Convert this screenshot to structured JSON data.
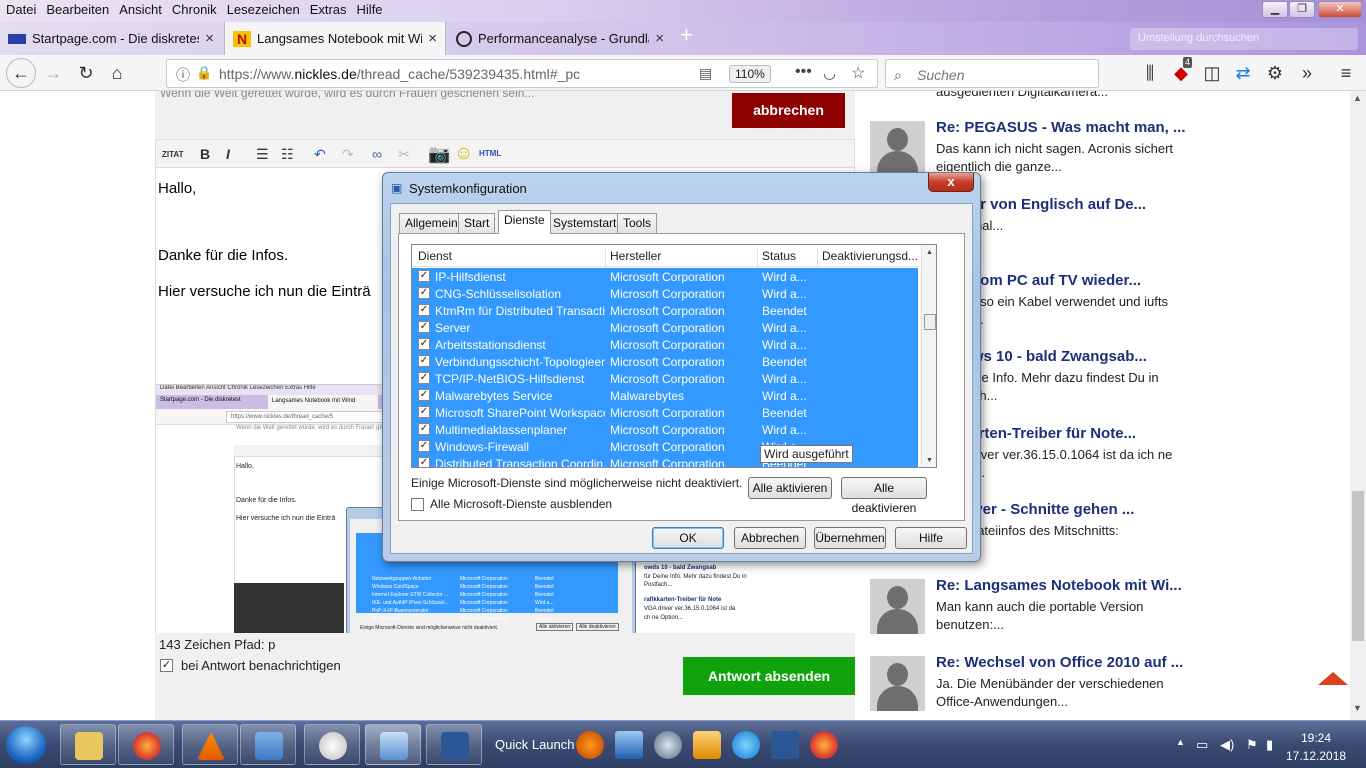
{
  "menu": [
    "Datei",
    "Bearbeiten",
    "Ansicht",
    "Chronik",
    "Lesezeichen",
    "Extras",
    "Hilfe"
  ],
  "tabs": [
    {
      "label": "Startpage.com - Die diskreteste",
      "close": "×"
    },
    {
      "label": "Langsames Notebook mit Windo",
      "close": "×"
    },
    {
      "label": "Performanceanalyse - Grundlage",
      "close": "×"
    }
  ],
  "newtab": "+",
  "ghost_search": "Umstellung durchsuchen",
  "nav": {
    "url_prefix": "https://www.",
    "url_domain": "nickles.de",
    "url_path": "/thread_cache/539239435.html#_pc",
    "zoom": "110%",
    "search_placeholder": "Suchen",
    "badge": "4"
  },
  "page": {
    "partial_line": "Wenn die Welt gerettet würde, wird es durch Frauen geschehen sein...",
    "cancel": "abbrechen",
    "toolbar": {
      "zitat": "ZITAT",
      "bold": "B",
      "italic": "I",
      "html": "HTML"
    },
    "editor_lines": [
      "Hallo,",
      "Danke für die Infos.",
      "Hier versuche ich nun die Einträ"
    ],
    "status": "143 Zeichen Pfad: p",
    "notify": "bei Antwort benachrichtigen",
    "send": "Antwort absenden"
  },
  "inner": {
    "menu": "Datei  Bearbeiten  Ansicht  Chronik  Lesezeichen  Extras  Hilfe",
    "tab1": "Startpage.com - Die diskretest",
    "tab2": "Langsames Notebook mit Wind",
    "url": "https://www.nickles.de/thread_cache/5",
    "partial": "Wenn die Welt gerettet würde, wird es durch Frauen ge",
    "lines": [
      "Hallo,",
      "Danke für die Infos.",
      "Hier versuche ich nun die Einträ"
    ],
    "rows": [
      [
        "Netzwerkgruppen-Anbieter",
        "Microsoft Corporation",
        "Beendet"
      ],
      [
        "Windows CardSpace",
        "Microsoft Corporation",
        "Beendet"
      ],
      [
        "Internet Explorer ETW Collector ...",
        "Microsoft Corporation",
        "Beendet"
      ],
      [
        "IKE- und AuthIP IPsec-Schlüssel...",
        "Microsoft Corporation",
        "Wird a..."
      ],
      [
        "PnP-X-IP-Busenumerator",
        "Microsoft Corporation",
        "Beendet"
      ],
      [
        "IP-Hilfsdienst",
        "Microsoft Corporation",
        "Wird a..."
      ]
    ],
    "note": "Einige Microsoft-Dienste sind möglicherweise nicht deaktiviert.",
    "btn1": "Alle aktivieren",
    "btn2": "Alle deaktivieren",
    "right1": "owds 10 - bald Zwangsab",
    "right2": "für Deine Info. Mehr dazu findest Du in",
    "right3": "Postfach...",
    "right4": "rafikkarten-Treiber für Note",
    "right5": "VGA driver ver.36.15.0.1064 ist da",
    "right6": "ch ne Option..."
  },
  "right_posts": [
    {
      "title": "",
      "text": "ausgedienten Digitalkamera...",
      "avatar": false
    },
    {
      "title": "Re: PEGASUS - Was macht man, ...",
      "text": "Das kann ich nicht sagen. Acronis sichert eigentlich die ganze...",
      "avatar": true
    },
    {
      "title": "astatur von Englisch auf De...",
      "text": "ne es mal...",
      "avatar": false
    },
    {
      "title": "otos vom PC auf TV wieder...",
      "text": "t hat er so ein Kabel verwendet und iufts sowas...",
      "avatar": false
    },
    {
      "title": "/indows 10 - bald Zwangsab...",
      "text": "für Deine Info. Mehr dazu findest Du in Postfach...",
      "avatar": false
    },
    {
      "title": "afikkarten-Treiber für Note...",
      "text": "VGA driver ver.36.15.0.1064 ist da ich ne Option...",
      "avatar": false
    },
    {
      "title": "C-Player - Schnitte gehen ...",
      "text": "h die Dateiinfos des Mitschnitts:",
      "avatar": false
    },
    {
      "title": "Re: Langsames Notebook mit Wi...",
      "text": "Man kann auch die portable Version benutzen:...",
      "avatar": true
    },
    {
      "title": "Re: Wechsel von Office 2010 auf ...",
      "text": "Ja. Die Menübänder der verschiedenen Office-Anwendungen...",
      "avatar": true
    }
  ],
  "dialog": {
    "title": "Systemkonfiguration",
    "close": "x",
    "tabs": [
      "Allgemein",
      "Start",
      "Dienste",
      "Systemstart",
      "Tools"
    ],
    "selected_tab": "Dienste",
    "columns": [
      "Dienst",
      "Hersteller",
      "Status",
      "Deaktivierungsd..."
    ],
    "rows": [
      {
        "name": "IP-Hilfsdienst",
        "vendor": "Microsoft Corporation",
        "status": "Wird a..."
      },
      {
        "name": "CNG-Schlüsselisolation",
        "vendor": "Microsoft Corporation",
        "status": "Wird a..."
      },
      {
        "name": "KtmRm für Distributed Transacti...",
        "vendor": "Microsoft Corporation",
        "status": "Beendet"
      },
      {
        "name": "Server",
        "vendor": "Microsoft Corporation",
        "status": "Wird a..."
      },
      {
        "name": "Arbeitsstationsdienst",
        "vendor": "Microsoft Corporation",
        "status": "Wird a..."
      },
      {
        "name": "Verbindungsschicht-Topologieer...",
        "vendor": "Microsoft Corporation",
        "status": "Beendet"
      },
      {
        "name": "TCP/IP-NetBIOS-Hilfsdienst",
        "vendor": "Microsoft Corporation",
        "status": "Wird a..."
      },
      {
        "name": "Malwarebytes Service",
        "vendor": "Malwarebytes",
        "status": "Wird a..."
      },
      {
        "name": "Microsoft SharePoint Workspace...",
        "vendor": "Microsoft Corporation",
        "status": "Beendet"
      },
      {
        "name": "Multimediaklassenplaner",
        "vendor": "Microsoft Corporation",
        "status": "Wird a..."
      },
      {
        "name": "Windows-Firewall",
        "vendor": "Microsoft Corporation",
        "status": "Wird a..."
      },
      {
        "name": "Distributed Transaction Coordin...",
        "vendor": "Microsoft Corporation",
        "status": "Beendet"
      }
    ],
    "tooltip": "Wird ausgeführt",
    "note": "Einige Microsoft-Dienste sind möglicherweise nicht deaktiviert.",
    "enable_all": "Alle aktivieren",
    "disable_all": "Alle deaktivieren",
    "hide_ms": "Alle Microsoft-Dienste ausblenden",
    "ok": "OK",
    "cancel": "Abbrechen",
    "apply": "Übernehmen",
    "help": "Hilfe"
  },
  "taskbar": {
    "quick_launch": "Quick Launch",
    "time": "19:24",
    "date": "17.12.2018"
  },
  "colors": {
    "accent": "#3399ff",
    "cancel_red": "#8d0000",
    "send_green": "#11a30e",
    "link_blue": "#1c2f78"
  }
}
